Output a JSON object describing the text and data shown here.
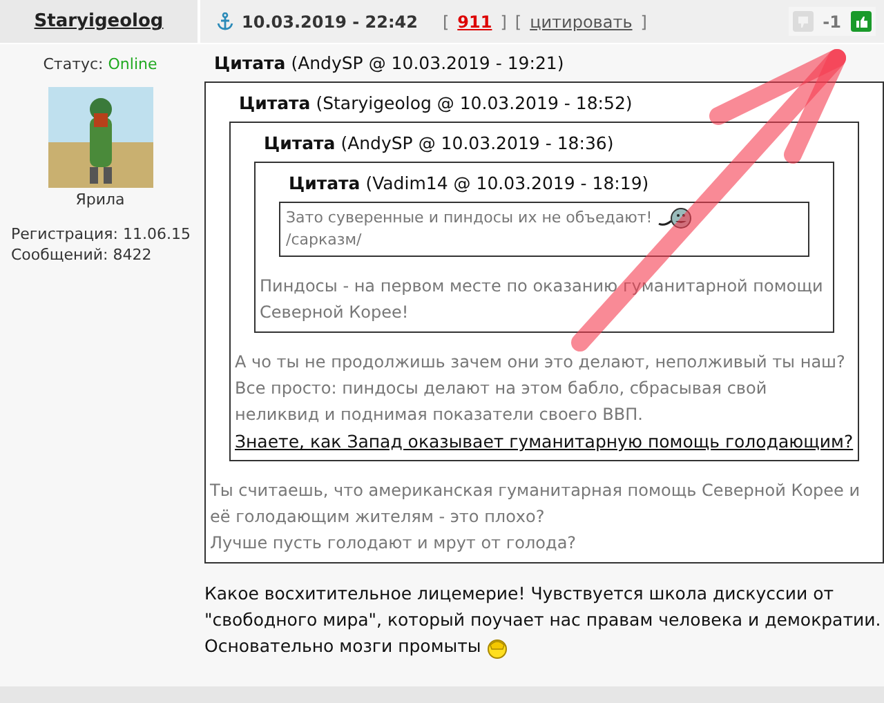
{
  "post": {
    "author": "Staryigeolog",
    "date": "10.03.2019 - 22:42",
    "links": [
      {
        "kind": "number",
        "text": "911"
      },
      {
        "kind": "action",
        "text": "цитировать"
      }
    ],
    "bracket_open": "[",
    "bracket_close": "]",
    "rating": {
      "value": "-1"
    },
    "status": {
      "label": "Статус:",
      "value": "Online",
      "online": true
    },
    "nickname": "Ярила",
    "stats": [
      {
        "label": "Регистрация:",
        "value": "11.06.15"
      },
      {
        "label": "Сообщений:",
        "value": "8422"
      }
    ],
    "quote": {
      "header": "**Цитата** (AndySP @ 10.03.2019 - 19:21)",
      "quote": {
        "header": "**Цитата** (Staryigeolog @ 10.03.2019 - 18:52)",
        "quote": {
          "header": "**Цитата** (AndySP @ 10.03.2019 - 18:36)",
          "quote": {
            "header": "**Цитата** (Vadim14 @ 10.03.2019 - 18:19)",
            "lines": [
              {
                "kind": "text",
                "text": "Зато суверенные и пиндосы их не объедают!"
              },
              {
                "kind": "text",
                "text": "/сарказм/"
              }
            ]
          },
          "lines": [
            {
              "kind": "text",
              "text": "Пиндосы - на первом месте по оказанию гуманитарной помощи Северной Корее!"
            }
          ]
        },
        "lines": [
          {
            "kind": "text",
            "text": "А чо ты не продолжишь зачем они это делают, неполживый ты наш?"
          },
          {
            "kind": "text",
            "text": "Все просто: пиндосы делают на этом бабло, сбрасывая свой неликвид и поднимая показатели своего ВВП."
          },
          {
            "kind": "link",
            "text": "Знаете, как Запад оказывает гуманитарную помощь голодающим?"
          }
        ]
      },
      "lines": [
        {
          "kind": "text",
          "text": "Ты считаешь, что американская гуманитарная помощь Северной Корее и её голодающим жителям - это плохо?"
        },
        {
          "kind": "text",
          "text": "Лучше пусть голодают и мрут от голода?"
        }
      ]
    },
    "body": [
      {
        "kind": "text",
        "text": "Какое восхитительное лицемерие! Чувствуется школа дискуссии от \"свободного мира\", который поучает нас правам человека и демократии."
      },
      {
        "kind": "text",
        "text": "Основательно мозги промыты"
      }
    ]
  }
}
